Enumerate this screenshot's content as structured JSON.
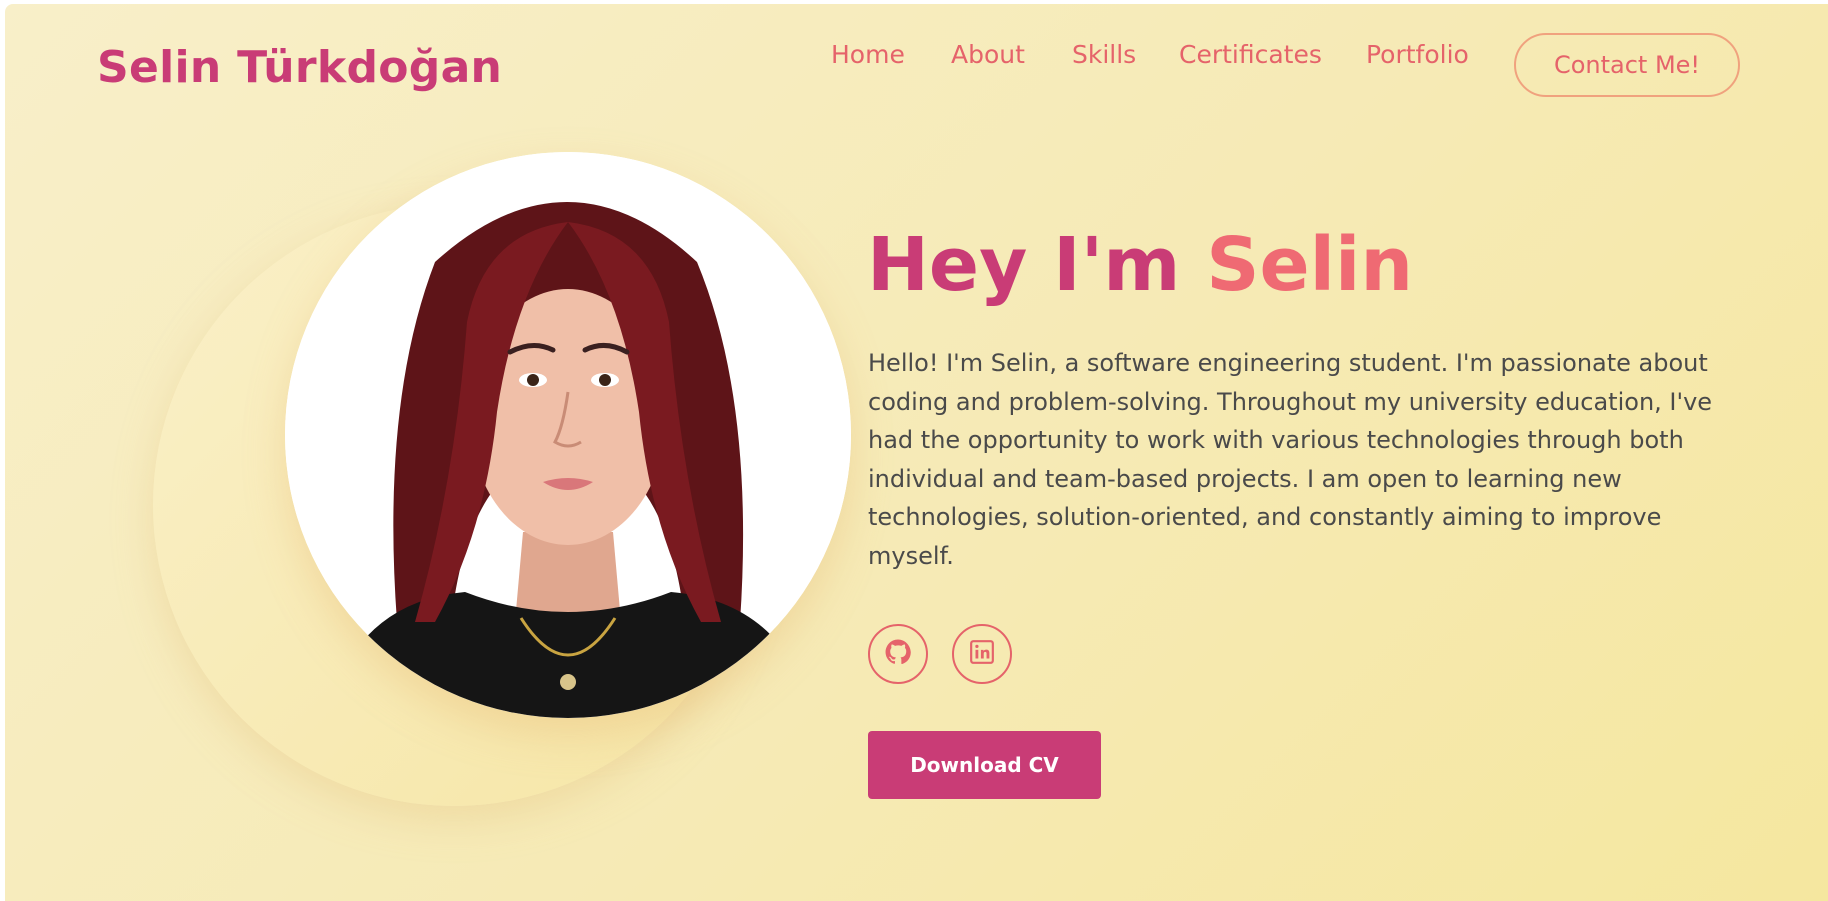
{
  "header": {
    "logo": "Selin Türkdoğan",
    "nav": [
      "Home",
      "About",
      "Skills",
      "Certificates",
      "Portfolio"
    ],
    "contact_label": "Contact Me!"
  },
  "hero": {
    "greeting": "Hey I'm",
    "name": "Selin",
    "bio": "Hello! I'm Selin, a software engineering student. I'm passionate about coding and problem-solving. Throughout my university education, I've had the opportunity to work with various technologies through both individual and team-based projects. I am open to learning new technologies, solution-oriented, and constantly aiming to improve myself.",
    "social_icons": [
      "github-icon",
      "linkedin-icon"
    ],
    "download_label": "Download CV"
  },
  "colors": {
    "primary": "#c93c76",
    "accent": "#ef6a73",
    "background": "#f6eab5",
    "text": "#4a4a4a"
  }
}
